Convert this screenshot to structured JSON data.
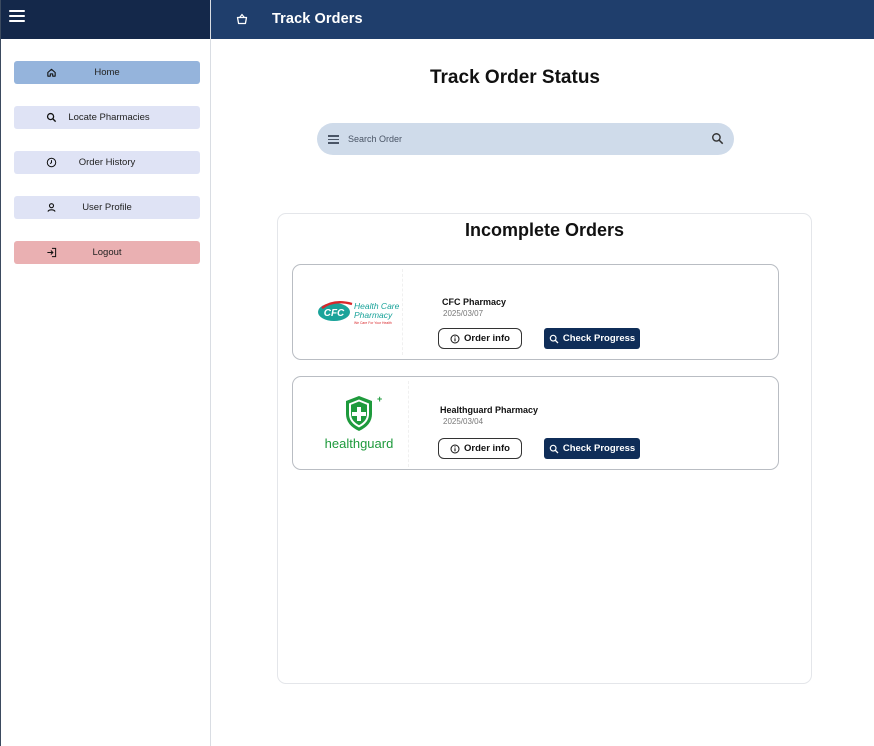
{
  "sidebar": {
    "items": [
      {
        "label": "Home",
        "icon": "home-icon"
      },
      {
        "label": "Locate Pharmacies",
        "icon": "search-icon"
      },
      {
        "label": "Order History",
        "icon": "clock-icon"
      },
      {
        "label": "User Profile",
        "icon": "user-icon"
      },
      {
        "label": "Logout",
        "icon": "logout-icon"
      }
    ]
  },
  "topbar": {
    "title": "Track Orders",
    "icon": "basket-icon"
  },
  "main": {
    "heading": "Track Order Status",
    "search": {
      "placeholder": "Search Order"
    },
    "panel_title": "Incomplete Orders",
    "orders": [
      {
        "name": "CFC Pharmacy",
        "date": "2025/03/07",
        "logo_text": "CFC",
        "logo_line1": "Health Care",
        "logo_line2": "Pharmacy",
        "logo_tagline": "We Care For Your Health",
        "info_label": "Order info",
        "progress_label": "Check Progress"
      },
      {
        "name": "Healthguard  Pharmacy",
        "date": "2025/03/04",
        "logo_text": "healthguard",
        "info_label": "Order info",
        "progress_label": "Check Progress"
      }
    ]
  },
  "colors": {
    "topbar": "#1f3e6c",
    "sidebar_top": "#14284a",
    "nav_active": "#95b4dc",
    "nav_item": "#dfe3f5",
    "logout": "#eab0b2",
    "search_bg": "#cfdbea",
    "progress_btn": "#0f2d58",
    "cfc_teal": "#1aa39a",
    "cfc_red": "#d9262a",
    "healthguard_green": "#1e9a3c"
  }
}
